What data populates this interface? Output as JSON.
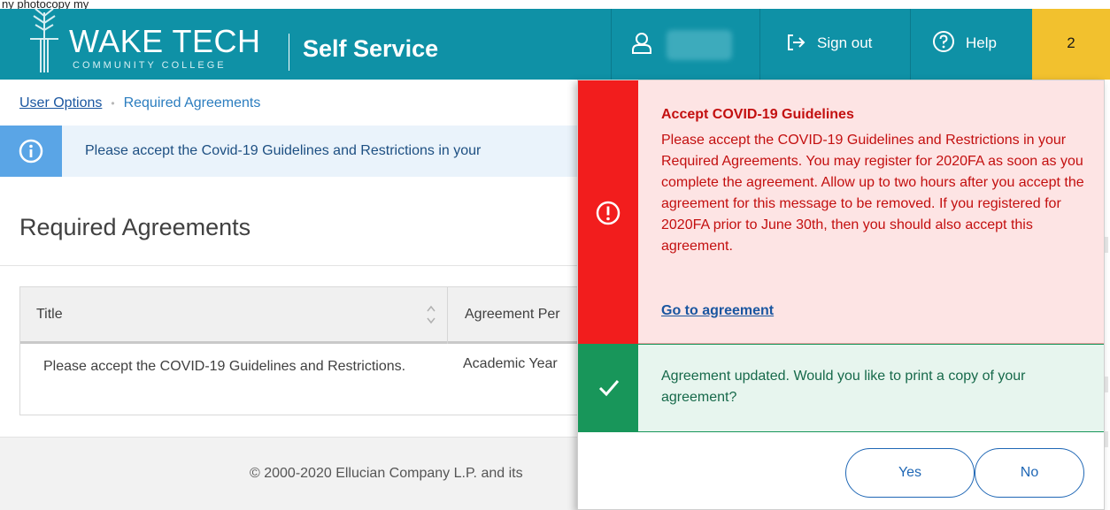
{
  "caption": "ny photocopy my",
  "header": {
    "logo_main": "WAKE TECH",
    "logo_sub": "COMMUNITY COLLEGE",
    "app_name": "Self Service",
    "signout_label": "Sign out",
    "help_label": "Help",
    "notification_count": "2"
  },
  "breadcrumb": {
    "parent": "User Options",
    "separator": "•",
    "current": "Required Agreements"
  },
  "info_banner": "Please accept the Covid-19 Guidelines and Restrictions in your",
  "page_title": "Required Agreements",
  "table": {
    "columns": [
      "Title",
      "Agreement Per"
    ],
    "rows": [
      [
        "Please accept the COVID-19 Guidelines and Restrictions.",
        "Academic Year"
      ]
    ]
  },
  "footer": "© 2000-2020 Ellucian Company L.P. and its",
  "notifications": {
    "error": {
      "title": "Accept COVID-19 Guidelines",
      "body": "Please accept the COVID-19 Guidelines and Restrictions in your Required Agreements. You may register for 2020FA as soon as you complete the agreement. Allow up to two hours after you accept the agreement for this message to be removed. If you registered for 2020FA prior to June 30th, then you should also accept this agreement.",
      "link": "Go to agreement"
    },
    "success": {
      "message": "Agreement updated. Would you like to print a copy of your agreement?"
    },
    "yes_label": "Yes",
    "no_label": "No"
  },
  "colors": {
    "header": "#0f91a6",
    "notification_badge": "#f2c12e",
    "error": "#f21d1d",
    "success": "#18965a",
    "info": "#5aa5e6",
    "link": "#1a56a0"
  },
  "icons": {
    "user": "user-icon",
    "signout": "sign-out-icon",
    "help": "help-icon",
    "info": "info-icon",
    "error": "alert-icon",
    "success": "check-icon",
    "sort": "sort-icon"
  }
}
